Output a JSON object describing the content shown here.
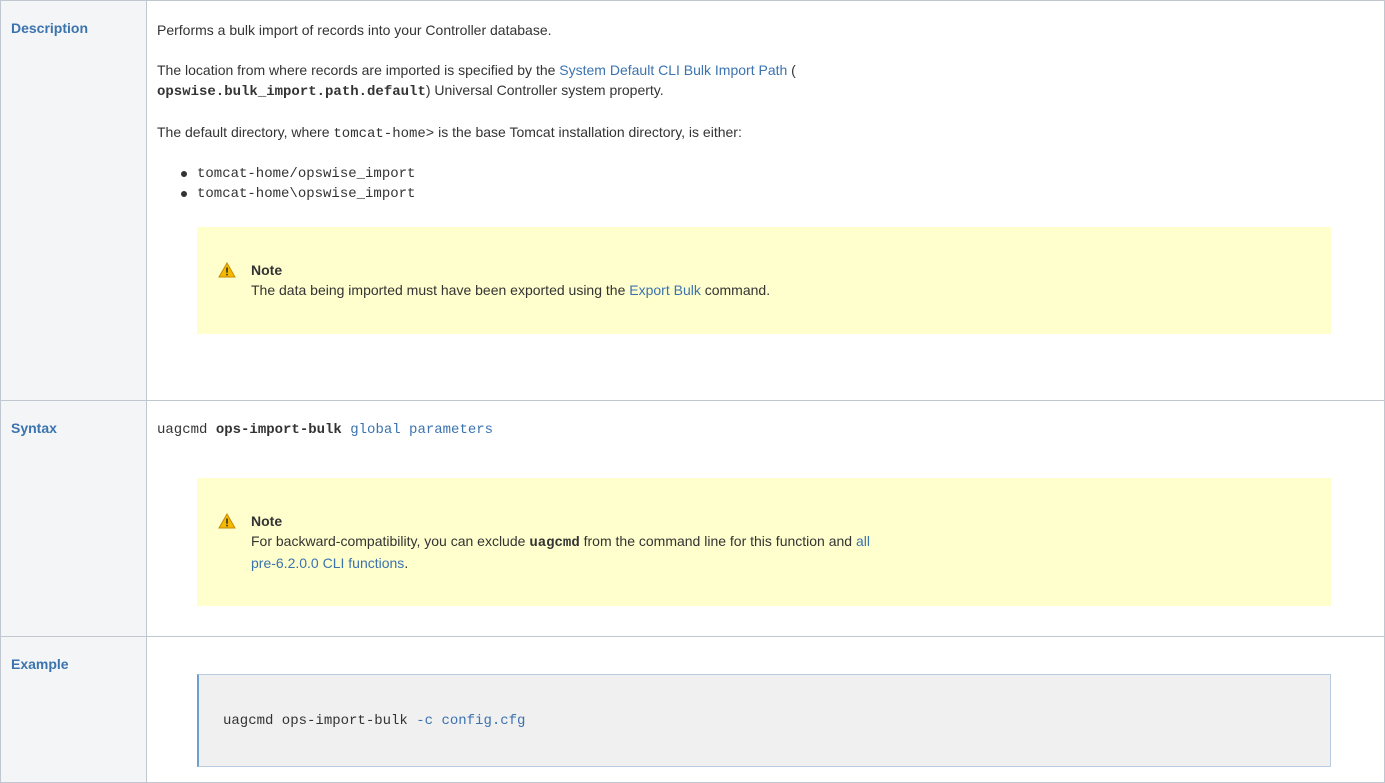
{
  "rows": {
    "description": {
      "label": "Description",
      "intro": "Performs a bulk import of records into your Controller database.",
      "location_pre": "The location from where records are imported is specified by the ",
      "location_link": "System Default CLI Bulk Import Path",
      "location_paren": " (",
      "location_property": "opswise.bulk_import.path.default",
      "location_post": ") Universal Controller system property.",
      "default_pre": "The default directory, where ",
      "default_code": "tomcat-home>",
      "default_post": " is the base Tomcat installation directory, is either:",
      "paths": [
        "tomcat-home/opswise_import",
        "tomcat-home\\opswise_import"
      ],
      "note": {
        "title": "Note",
        "text_pre": "The data being imported must have been exported using the ",
        "link": "Export Bulk",
        "text_post": " command."
      }
    },
    "syntax": {
      "label": "Syntax",
      "cmd": "uagcmd ",
      "function": "ops-import-bulk",
      "params": " global parameters",
      "note": {
        "title": "Note",
        "text_pre": "For backward-compatibility, you can exclude ",
        "code": "uagcmd",
        "text_mid": " from the command line for this function and ",
        "link_line1": "all",
        "link_line2": "pre-6.2.0.0 CLI functions",
        "text_post": "."
      }
    },
    "example": {
      "label": "Example",
      "cmd": "uagcmd ops-import-bulk ",
      "opt": "-c",
      "arg": " config.cfg"
    }
  },
  "colors": {
    "link": "#3b73af",
    "note_bg": "#ffffce",
    "header_bg": "#f4f5f7",
    "warning": "#f5b900"
  },
  "icons": {
    "note": "warning-icon"
  }
}
